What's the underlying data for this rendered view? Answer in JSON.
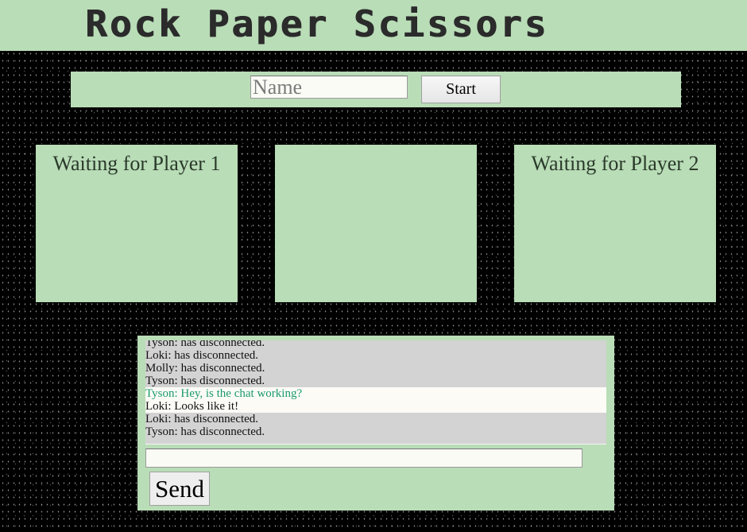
{
  "app": {
    "title": "Rock Paper Scissors"
  },
  "name_form": {
    "name_placeholder": "Name",
    "name_value": "",
    "start_label": "Start"
  },
  "panels": {
    "player1_status": "Waiting for Player 1",
    "center_text": "",
    "player2_status": "Waiting for Player 2"
  },
  "chat": {
    "messages": [
      {
        "text": "Tyson: has disconnected.",
        "kind": "system"
      },
      {
        "text": "Loki: has disconnected.",
        "kind": "system"
      },
      {
        "text": "Molly: has disconnected.",
        "kind": "system"
      },
      {
        "text": "Tyson: has disconnected.",
        "kind": "system"
      },
      {
        "text": "Tyson: Hey, is the chat working?",
        "kind": "chat-self"
      },
      {
        "text": "Loki: Looks like it!",
        "kind": "chat-other"
      },
      {
        "text": "Loki: has disconnected.",
        "kind": "system"
      },
      {
        "text": "Tyson: has disconnected.",
        "kind": "system"
      }
    ],
    "input_value": "",
    "send_label": "Send"
  },
  "colors": {
    "panel_bg": "#b9ddb7",
    "page_bg": "#000000",
    "self_message": "#1a9a6e",
    "system_message_bg": "#d3d3d3",
    "chat_message_bg": "#fcfbf6"
  }
}
